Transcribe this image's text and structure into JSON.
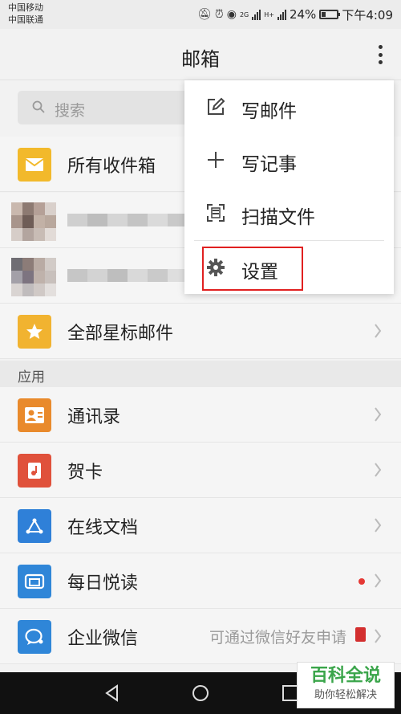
{
  "status_bar": {
    "carrier_1": "中国移动",
    "carrier_2": "中国联通",
    "network_1": "2G",
    "network_2": "H+",
    "battery": "24%",
    "time": "下午4:09",
    "icons": [
      "mute-icon",
      "alarm-icon",
      "eye-icon",
      "signal-icon",
      "battery-icon"
    ]
  },
  "header": {
    "title": "邮箱",
    "more_icon": "more-vertical-icon"
  },
  "search": {
    "placeholder": "搜索"
  },
  "mail": {
    "all_inbox": "所有收件箱",
    "starred": "全部星标邮件"
  },
  "apps_section": {
    "title": "应用",
    "items": [
      {
        "label": "通讯录",
        "icon": "contacts-icon",
        "color": "#e98a2c"
      },
      {
        "label": "贺卡",
        "icon": "card-icon",
        "color": "#e0513b"
      },
      {
        "label": "在线文档",
        "icon": "document-icon",
        "color": "#2f80d8"
      },
      {
        "label": "每日悦读",
        "icon": "reading-icon",
        "color": "#2f86d8"
      },
      {
        "label": "企业微信",
        "icon": "wechat-work-icon",
        "color": "#2f86d8",
        "hint": "可通过微信好友申请"
      }
    ]
  },
  "menu": {
    "items": [
      {
        "label": "写邮件",
        "icon": "compose-icon"
      },
      {
        "label": "写记事",
        "icon": "plus-icon"
      },
      {
        "label": "扫描文件",
        "icon": "scan-icon"
      },
      {
        "label": "设置",
        "icon": "gear-icon",
        "highlighted": true
      }
    ]
  },
  "watermark": {
    "title": "百科全说",
    "subtitle": "助你轻松解决"
  },
  "colors": {
    "inbox_yellow": "#f2b92b",
    "star_yellow": "#f1b330",
    "highlight_red": "#e02020"
  }
}
